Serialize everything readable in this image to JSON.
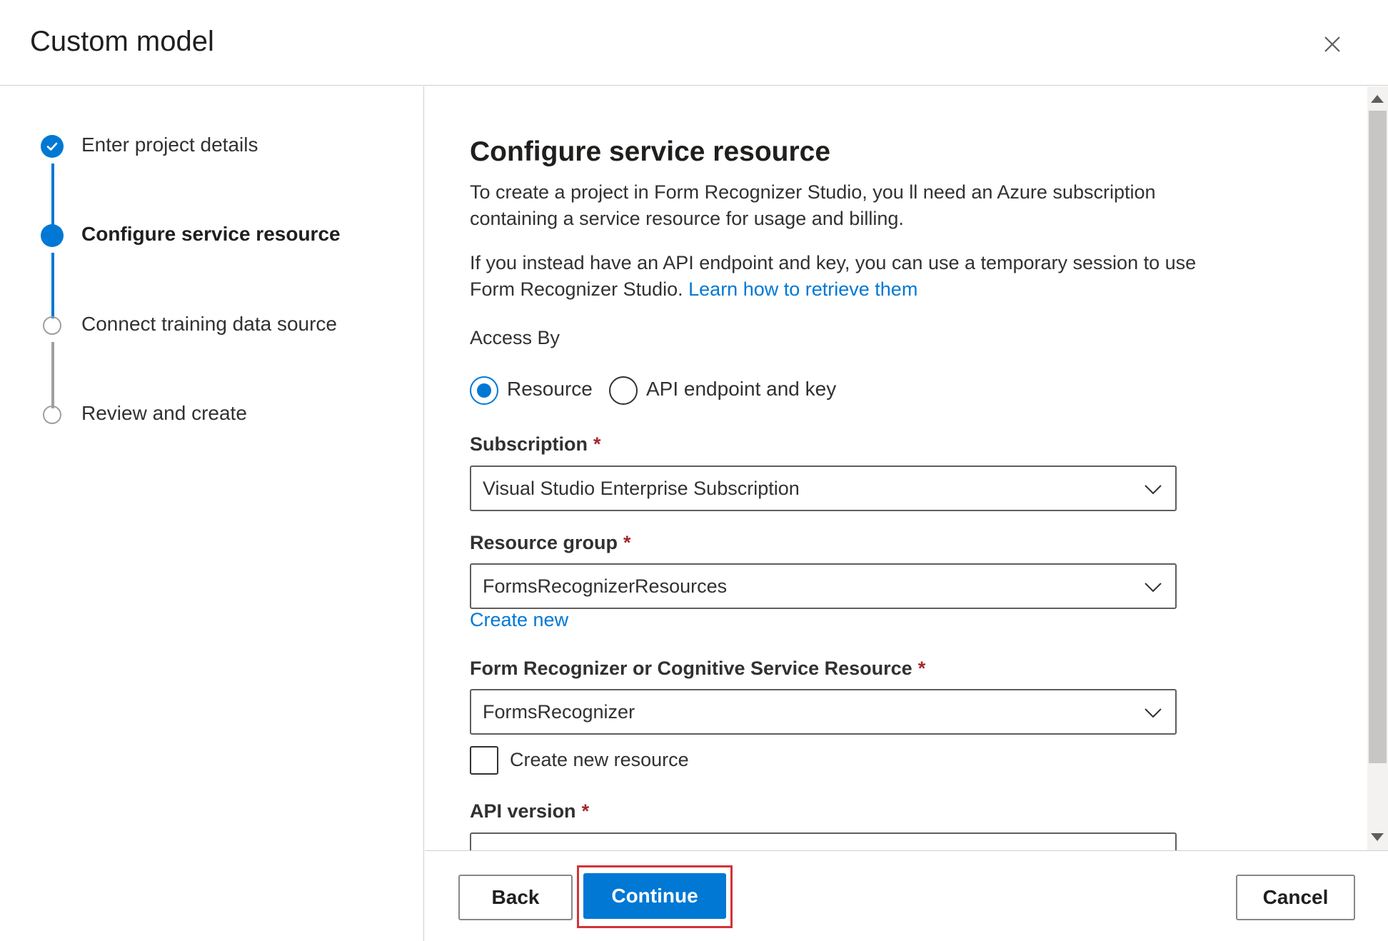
{
  "dialog": {
    "title": "Custom model",
    "close_icon": "close-icon"
  },
  "steps": [
    {
      "label": "Enter project details",
      "status": "completed"
    },
    {
      "label": "Configure service resource",
      "status": "current"
    },
    {
      "label": "Connect training data source",
      "status": "todo"
    },
    {
      "label": "Review and create",
      "status": "todo"
    }
  ],
  "content": {
    "heading": "Configure service resource",
    "intro": "To create a project in Form Recognizer Studio, you ll need an Azure subscription containing a service resource for usage and billing.",
    "alt_text": "If you instead have an API endpoint and key, you can use a temporary session to use Form Recognizer Studio.",
    "alt_link": "Learn how to retrieve them",
    "access_by": {
      "label": "Access By",
      "options": [
        "Resource",
        "API endpoint and key"
      ],
      "selected": "Resource"
    },
    "subscription": {
      "label": "Subscription",
      "required_mark": "*",
      "value": "Visual Studio Enterprise Subscription"
    },
    "resource_group": {
      "label": "Resource group",
      "required_mark": "*",
      "value": "FormsRecognizerResources",
      "create_link": "Create new"
    },
    "service_resource": {
      "label": "Form Recognizer or Cognitive Service Resource",
      "required_mark": "*",
      "value": "FormsRecognizer",
      "checkbox_label": "Create new resource",
      "checkbox_checked": false
    },
    "api_version": {
      "label": "API version",
      "required_mark": "*"
    }
  },
  "footer": {
    "back_label": "Back",
    "continue_label": "Continue",
    "cancel_label": "Cancel"
  },
  "colors": {
    "accent": "#0078d4",
    "highlight": "#d13438",
    "required": "#a4262c"
  }
}
